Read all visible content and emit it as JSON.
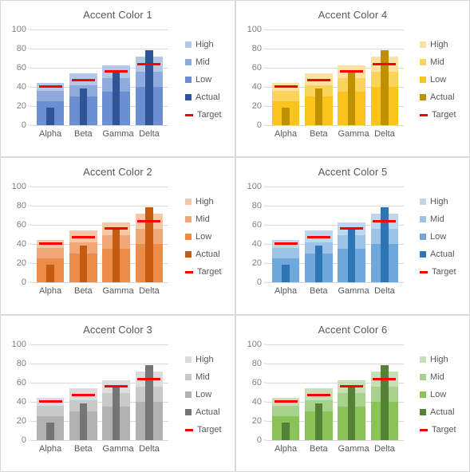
{
  "chart_data": [
    {
      "type": "bar",
      "title": "Accent Color 1",
      "subtitle": "",
      "xlabel": "",
      "ylabel": "",
      "categories": [
        "Alpha",
        "Beta",
        "Gamma",
        "Delta"
      ],
      "ylim": [
        0,
        100
      ],
      "yticks": [
        0,
        20,
        40,
        60,
        80,
        100
      ],
      "grid": true,
      "legend_position": "right",
      "series": [
        {
          "name": "High",
          "values": [
            44.5,
            54,
            62.5,
            72
          ],
          "color": "#b4c7e7"
        },
        {
          "name": "Mid",
          "values": [
            36,
            42,
            49,
            56
          ],
          "color": "#8faadc"
        },
        {
          "name": "Low",
          "values": [
            25,
            30,
            35,
            40
          ],
          "color": "#6c8fd4"
        },
        {
          "name": "Actual",
          "values": [
            18,
            38,
            56,
            78
          ],
          "color": "#2f5597"
        },
        {
          "name": "Target",
          "values": [
            40.5,
            47.5,
            56,
            64
          ],
          "color": "#ff0000"
        }
      ]
    },
    {
      "type": "bar",
      "title": "Accent Color 2",
      "subtitle": "",
      "xlabel": "",
      "ylabel": "",
      "categories": [
        "Alpha",
        "Beta",
        "Gamma",
        "Delta"
      ],
      "ylim": [
        0,
        100
      ],
      "yticks": [
        0,
        20,
        40,
        60,
        80,
        100
      ],
      "grid": true,
      "legend_position": "right",
      "series": [
        {
          "name": "High",
          "values": [
            44.5,
            54,
            62.5,
            72
          ],
          "color": "#f6c9a6"
        },
        {
          "name": "Mid",
          "values": [
            36,
            42,
            49,
            56
          ],
          "color": "#f0a878"
        },
        {
          "name": "Low",
          "values": [
            25,
            30,
            35,
            40
          ],
          "color": "#ed8c48"
        },
        {
          "name": "Actual",
          "values": [
            18,
            38,
            56,
            78
          ],
          "color": "#c55a11"
        },
        {
          "name": "Target",
          "values": [
            40.5,
            47.5,
            56,
            64
          ],
          "color": "#ff0000"
        }
      ]
    },
    {
      "type": "bar",
      "title": "Accent Color 3",
      "subtitle": "",
      "xlabel": "",
      "ylabel": "",
      "categories": [
        "Alpha",
        "Beta",
        "Gamma",
        "Delta"
      ],
      "ylim": [
        0,
        100
      ],
      "yticks": [
        0,
        20,
        40,
        60,
        80,
        100
      ],
      "grid": true,
      "legend_position": "right",
      "series": [
        {
          "name": "High",
          "values": [
            44.5,
            54,
            62.5,
            72
          ],
          "color": "#dcdcdc"
        },
        {
          "name": "Mid",
          "values": [
            36,
            42,
            49,
            56
          ],
          "color": "#c9c9c9"
        },
        {
          "name": "Low",
          "values": [
            25,
            30,
            35,
            40
          ],
          "color": "#b2b2b2"
        },
        {
          "name": "Actual",
          "values": [
            18,
            38,
            56,
            78
          ],
          "color": "#757575"
        },
        {
          "name": "Target",
          "values": [
            40.5,
            47.5,
            56,
            64
          ],
          "color": "#ff0000"
        }
      ]
    },
    {
      "type": "bar",
      "title": "Accent Color 4",
      "subtitle": "",
      "xlabel": "",
      "ylabel": "",
      "categories": [
        "Alpha",
        "Beta",
        "Gamma",
        "Delta"
      ],
      "ylim": [
        0,
        100
      ],
      "yticks": [
        0,
        20,
        40,
        60,
        80,
        100
      ],
      "grid": true,
      "legend_position": "right",
      "series": [
        {
          "name": "High",
          "values": [
            44.5,
            54,
            62.5,
            72
          ],
          "color": "#fbe2a0"
        },
        {
          "name": "Mid",
          "values": [
            36,
            42,
            49,
            56
          ],
          "color": "#fbd35b"
        },
        {
          "name": "Low",
          "values": [
            25,
            30,
            35,
            40
          ],
          "color": "#fbc41c"
        },
        {
          "name": "Actual",
          "values": [
            18,
            38,
            56,
            78
          ],
          "color": "#bf9000"
        },
        {
          "name": "Target",
          "values": [
            40.5,
            47.5,
            56,
            64
          ],
          "color": "#ff0000"
        }
      ]
    },
    {
      "type": "bar",
      "title": "Accent Color 5",
      "subtitle": "",
      "xlabel": "",
      "ylabel": "",
      "categories": [
        "Alpha",
        "Beta",
        "Gamma",
        "Delta"
      ],
      "ylim": [
        0,
        100
      ],
      "yticks": [
        0,
        20,
        40,
        60,
        80,
        100
      ],
      "grid": true,
      "legend_position": "right",
      "series": [
        {
          "name": "High",
          "values": [
            44.5,
            54,
            62.5,
            72
          ],
          "color": "#bdd7ee"
        },
        {
          "name": "Mid",
          "values": [
            36,
            42,
            49,
            56
          ],
          "color": "#9dc3e6"
        },
        {
          "name": "Low",
          "values": [
            25,
            30,
            35,
            40
          ],
          "color": "#6fa8dc"
        },
        {
          "name": "Actual",
          "values": [
            18,
            38,
            56,
            78
          ],
          "color": "#2e75b6"
        },
        {
          "name": "Target",
          "values": [
            40.5,
            47.5,
            56,
            64
          ],
          "color": "#ff0000"
        }
      ]
    },
    {
      "type": "bar",
      "title": "Accent Color 6",
      "subtitle": "",
      "xlabel": "",
      "ylabel": "",
      "categories": [
        "Alpha",
        "Beta",
        "Gamma",
        "Delta"
      ],
      "ylim": [
        0,
        100
      ],
      "yticks": [
        0,
        20,
        40,
        60,
        80,
        100
      ],
      "grid": true,
      "legend_position": "right",
      "series": [
        {
          "name": "High",
          "values": [
            44.5,
            54,
            62.5,
            72
          ],
          "color": "#c5e0b4"
        },
        {
          "name": "Mid",
          "values": [
            36,
            42,
            49,
            56
          ],
          "color": "#a9d18e"
        },
        {
          "name": "Low",
          "values": [
            25,
            30,
            35,
            40
          ],
          "color": "#8ac459"
        },
        {
          "name": "Actual",
          "values": [
            18,
            38,
            56,
            78
          ],
          "color": "#538135"
        },
        {
          "name": "Target",
          "values": [
            40.5,
            47.5,
            56,
            64
          ],
          "color": "#ff0000"
        }
      ]
    }
  ],
  "panel_order": [
    0,
    3,
    1,
    4,
    2,
    5
  ]
}
